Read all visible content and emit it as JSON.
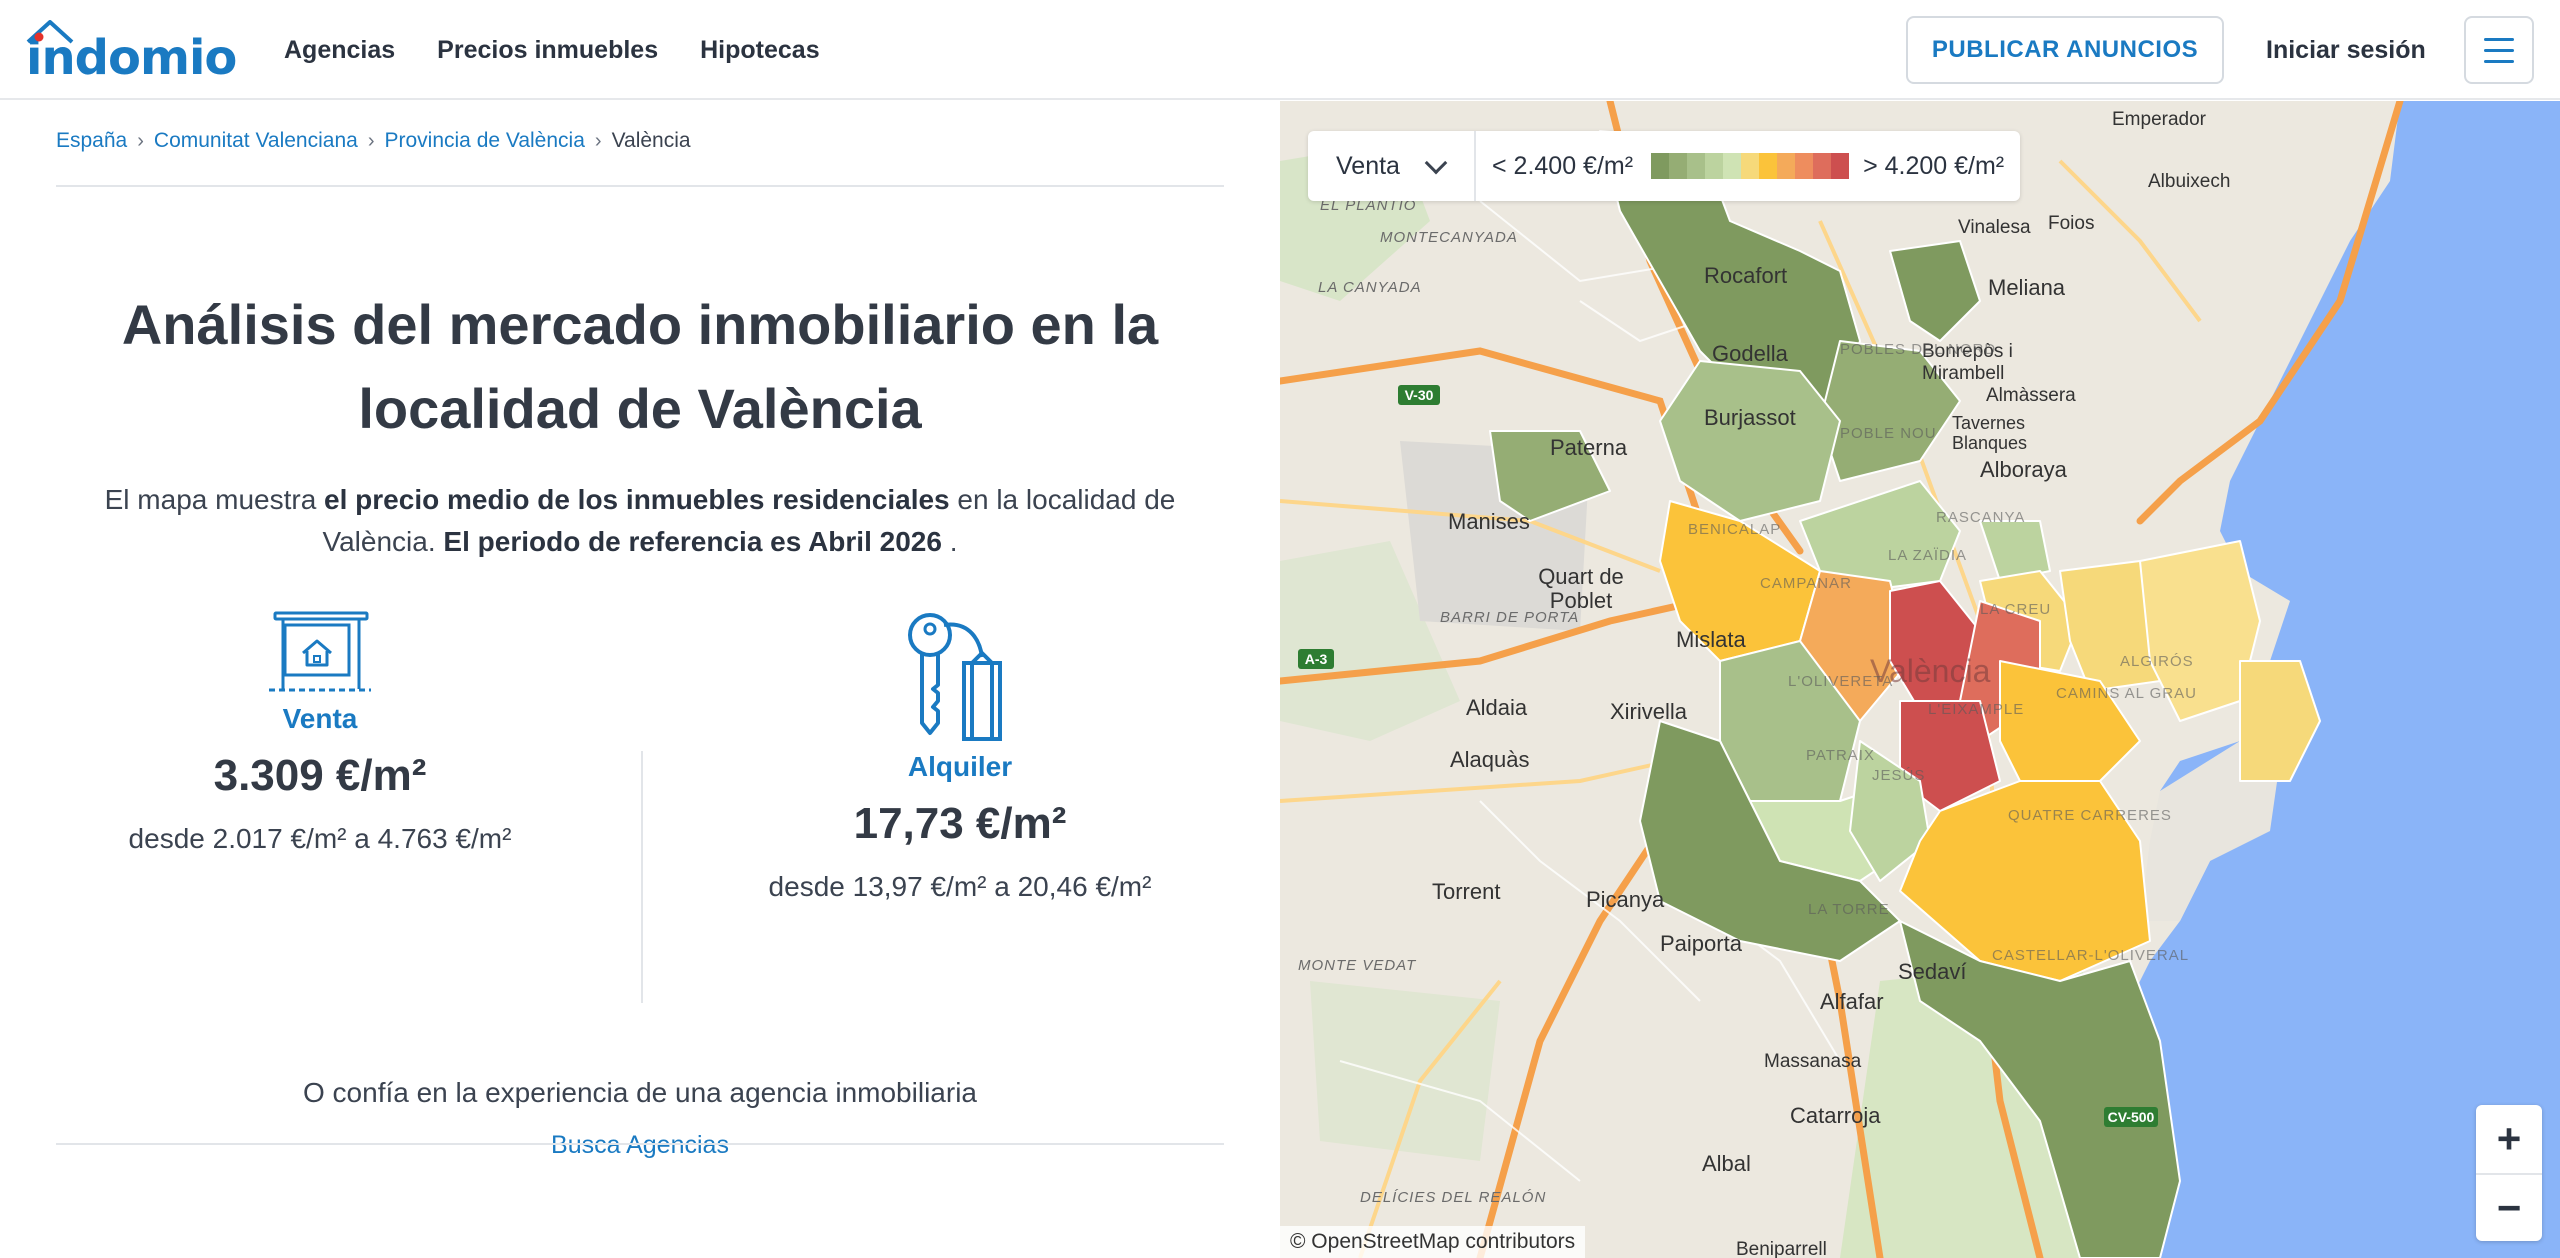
{
  "header": {
    "logo_text": "indomio",
    "nav": [
      "Agencias",
      "Precios inmuebles",
      "Hipotecas"
    ],
    "publish_label": "PUBLICAR ANUNCIOS",
    "login_label": "Iniciar sesión"
  },
  "breadcrumb": [
    "España",
    "Comunitat Valenciana",
    "Provincia de València",
    "València"
  ],
  "main": {
    "title": "Análisis del mercado inmobiliario en la localidad de València",
    "lede_1": "El mapa muestra ",
    "lede_bold_1": "el precio medio de los inmuebles residenciales",
    "lede_2": " en la localidad de València. ",
    "lede_bold_2": "El periodo de referencia es Abril 2026",
    "lede_3": " ."
  },
  "stats": {
    "sale": {
      "label": "Venta",
      "value": "3.309 €/m²",
      "range": "desde 2.017 €/m² a 4.763 €/m²"
    },
    "rent": {
      "label": "Alquiler",
      "value": "17,73 €/m²",
      "range": "desde 13,97 €/m² a 20,46 €/m²"
    }
  },
  "agency": {
    "text": "O confía en la experiencia de una agencia inmobiliaria",
    "link": "Busca Agencias"
  },
  "map": {
    "select_value": "Venta",
    "legend_min": "< 2.400 €/m²",
    "legend_max": "> 4.200 €/m²",
    "legend_colors": [
      "#7f9a5f",
      "#95ad74",
      "#a8c08a",
      "#bcd39f",
      "#cfe3b4",
      "#f6d97a",
      "#fbc33a",
      "#f4aa5a",
      "#ee8d5e",
      "#de6d5c",
      "#cd4f4f"
    ],
    "attribution": "© OpenStreetMap contributors",
    "zoom_in": "+",
    "zoom_out": "−",
    "places": {
      "rocafort": "Rocafort",
      "godella": "Godella",
      "burjassot": "Burjassot",
      "paterna": "Paterna",
      "manises": "Manises",
      "quart": "Quart de Poblet",
      "mislata": "Mislata",
      "aldaia": "Aldaia",
      "xirivella": "Xirivella",
      "alaquas": "Alaquàs",
      "torrent": "Torrent",
      "picanya": "Picanya",
      "paiporta": "Paiporta",
      "sedavi": "Sedaví",
      "alfafar": "Alfafar",
      "massanasa": "Massanasa",
      "catarroja": "Catarroja",
      "albal": "Albal",
      "meliana": "Meliana",
      "vinalesa": "Vinalesa",
      "foios": "Foios",
      "albuixech": "Albuixech",
      "emperador": "Emperador",
      "bonrepos": "Bonrepòs i Mirambell",
      "almassera": "Almàssera",
      "tavernes": "Tavernes Blanques",
      "alboraya": "Alboraya",
      "valencia": "València",
      "beniparrell": "Beniparrell"
    },
    "areas": {
      "plantio": "EL PLANTÍO",
      "montecanyada": "MONTECANYADA",
      "canyada": "LA CANYADA",
      "poblesnord": "POBLES DEL NORD",
      "poblenou": "POBLE NOU",
      "benicalap": "BENICALAP",
      "campanar": "CAMPANAR",
      "zaidia": "LA ZAÏDIA",
      "rascanya": "RASCANYA",
      "olivereta": "L'OLIVERETA",
      "patraix": "PATRAIX",
      "jesus": "JESÚS",
      "quatrecarreres": "QUATRE CARRERES",
      "torre": "LA TORRE",
      "castellar": "CASTELLAR-L'OLIVERAL",
      "camins": "CAMINS AL GRAU",
      "algiros": "ALGIRÓS",
      "eixample": "L'EIXAMPLE",
      "placareal": "LA CREU",
      "barri": "BARRI DE PORTA",
      "delicies": "DELÍCIES DEL REALÓN",
      "montevedat": "MONTE VEDAT"
    },
    "road_labels": {
      "v30": "V-30",
      "a3": "A-3",
      "cv500": "CV-500"
    }
  }
}
